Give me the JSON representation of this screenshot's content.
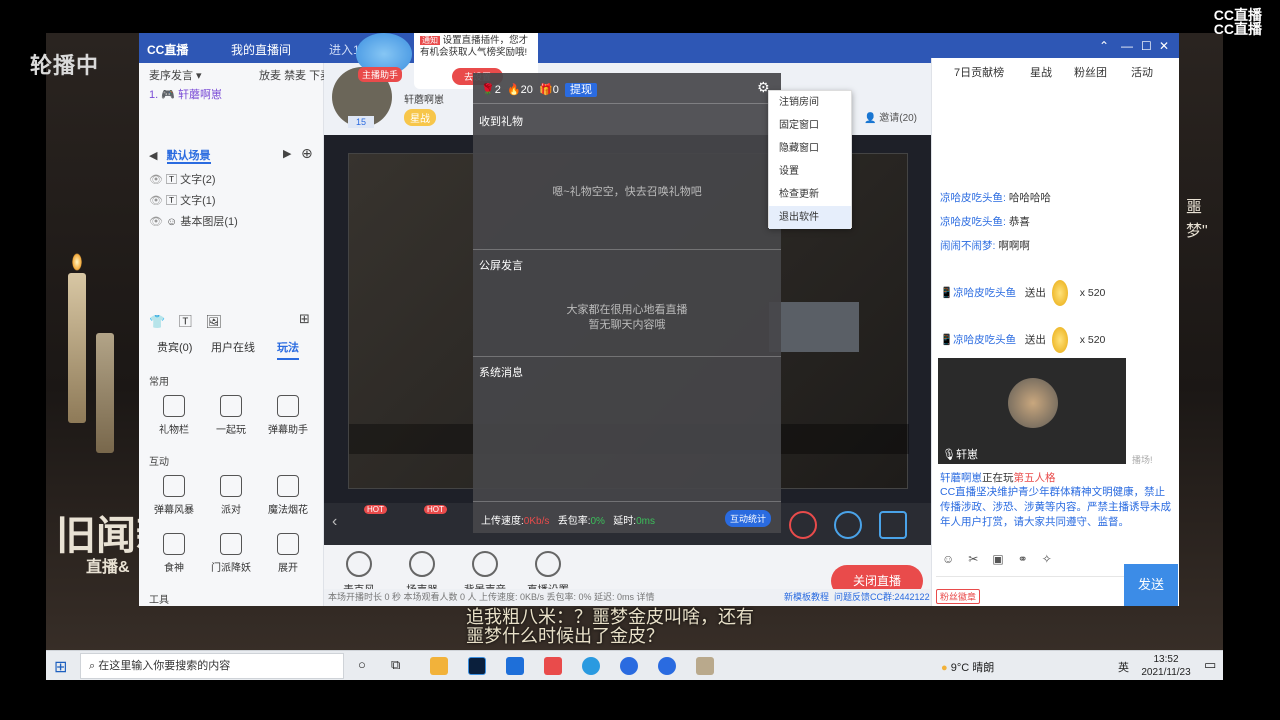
{
  "overlay": {
    "live_badge": "轮播中",
    "brand": "CC直播",
    "brand2": "CC直播"
  },
  "titlebar": {
    "app_name": "CC直播",
    "tab": "我的直播间",
    "enter_text": "进入15748日",
    "controls": [
      "⌃",
      "—",
      "☐",
      "✕"
    ]
  },
  "popup_tip": {
    "tag": "通知",
    "text": "设置直播插件，您才有机会获取人气榜奖励哦!",
    "button": "去设置",
    "assistant": "主播助手"
  },
  "left_panel": {
    "mic_mode": "麦序发言",
    "mic_btns": [
      "放麦",
      "禁麦",
      "下麦"
    ],
    "mic_user": "轩蘑啊崽",
    "scene_title": "默认场景",
    "layers": [
      "文字(2)",
      "文字(1)",
      "基本图层(1)"
    ],
    "tabs": [
      "贵宾(0)",
      "用户在线",
      "玩法"
    ],
    "section_common": "常用",
    "common_items": [
      "礼物栏",
      "一起玩",
      "弹幕助手"
    ],
    "section_interact": "互动",
    "interact_items": [
      "弹幕风暴",
      "派对",
      "魔法烟花",
      "食神",
      "门派降妖",
      "展开"
    ],
    "section_tools": "工具"
  },
  "streamer": {
    "name": "轩蘑啊崽",
    "level": "15",
    "badge": "星战",
    "invite": "邀请(20)"
  },
  "gift_panel": {
    "stats": [
      {
        "icon": "🌹",
        "value": "2"
      },
      {
        "icon": "🔥",
        "value": "20"
      },
      {
        "icon": "🎁",
        "value": "0"
      }
    ],
    "withdraw": "提现",
    "section_gifts": "收到礼物",
    "gifts_empty": "嗯~礼物空空，快去召唤礼物吧",
    "section_chat": "公屏发言",
    "chat_empty_1": "大家都在很用心地看直播",
    "chat_empty_2": "暂无聊天内容哦",
    "section_system": "系统消息",
    "upload_label": "上传速度:",
    "upload_value": "0Kb/s",
    "loss_label": "丢包率:",
    "loss_value": "0%",
    "delay_label": "延时:",
    "delay_value": "0ms",
    "stats_btn": "互动统计"
  },
  "menu": {
    "items": [
      "注销房间",
      "固定窗口",
      "隐藏窗口",
      "设置",
      "检查更新",
      "退出软件"
    ],
    "highlight_index": 5
  },
  "bottom_bar": {
    "buttons": [
      "麦克风",
      "扬声器",
      "背景声音",
      "直播设置"
    ],
    "close_live": "关闭直播",
    "status": "本场开播时长 0 秒   本场观看人数 0 人    上传速度: 0KB/s   丢包率: 0%   延迟: 0ms   详情",
    "links": [
      "新模板教程",
      "问题反馈CC群:2442122"
    ]
  },
  "gift_row_label": "HOT",
  "right_panel": {
    "tabs": [
      "7日贡献榜",
      "星战",
      "粉丝团",
      "活动"
    ],
    "chat": [
      {
        "user": "凉哈皮吃头鱼:",
        "text": "哈哈哈哈"
      },
      {
        "user": "凉哈皮吃头鱼:",
        "text": "恭喜"
      },
      {
        "user": "闹闹不闹梦:",
        "text": "啊啊啊"
      }
    ],
    "gift_events": [
      {
        "user": "凉哈皮吃头鱼",
        "action": "送出",
        "count": "x 520"
      },
      {
        "user": "凉哈皮吃头鱼",
        "action": "送出",
        "count": "x 520"
      }
    ],
    "video_user": "轩崽",
    "playing_user": "轩蘑啊崽",
    "playing_text": "正在玩",
    "playing_game": "第五人格",
    "notice": "CC直播坚决维护青少年群体精神文明健康，禁止传播涉政、涉恐、涉黄等内容。严禁主播诱导未成年人用户打赏，请大家共同遵守、监督。",
    "fan_badge": "粉丝徽章",
    "send": "发送",
    "side_text": "播场!"
  },
  "background_text": {
    "left_big": "旧闻新",
    "left_sub": "直播&",
    "caption_1": "追我粗八米：？噩梦金皮叫啥，还有",
    "caption_2": "噩梦什么时候出了金皮？",
    "right_quote": "噩梦\""
  },
  "taskbar": {
    "search_placeholder": "在这里输入你要搜索的内容",
    "weather": "9°C  晴朗",
    "ime": "英",
    "time": "13:52",
    "date": "2021/11/23"
  },
  "colors": {
    "accent": "#2a6be0",
    "titlebar": "#2e57b5",
    "close_live": "#e94b4b",
    "highlight_red": "#e94b4b"
  }
}
